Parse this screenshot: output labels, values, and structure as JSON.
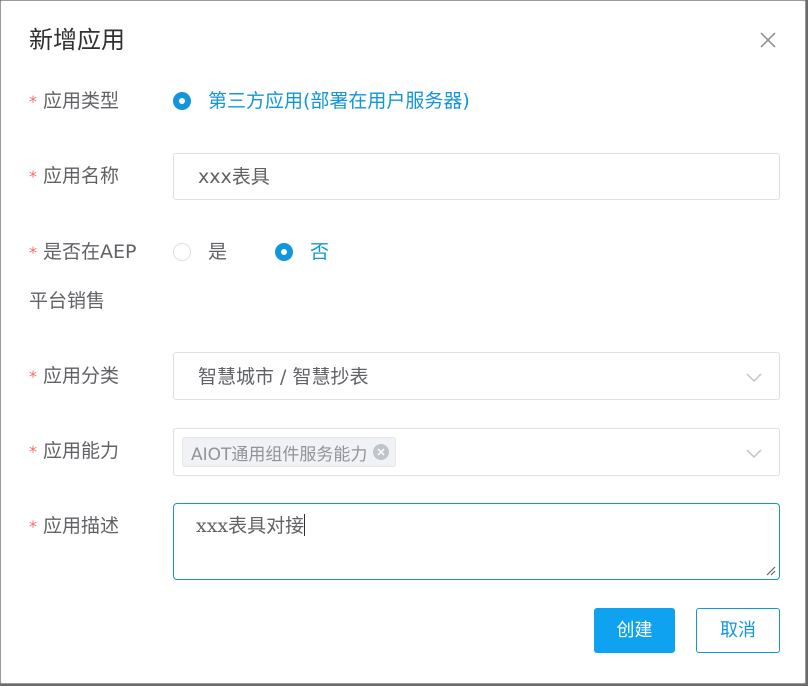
{
  "dialog": {
    "title": "新增应用",
    "close_icon": "close-icon"
  },
  "form": {
    "required_mark": "*",
    "app_type": {
      "label": "应用类型",
      "options": [
        {
          "label": "第三方应用(部署在用户服务器)",
          "selected": true
        }
      ]
    },
    "app_name": {
      "label": "应用名称",
      "value": "xxx表具"
    },
    "aep_sale": {
      "label_line1": "是否在AEP",
      "label_line2": "平台销售",
      "options": [
        {
          "label": "是",
          "selected": false
        },
        {
          "label": "否",
          "selected": true
        }
      ]
    },
    "category": {
      "label": "应用分类",
      "value": "智慧城市 / 智慧抄表"
    },
    "capability": {
      "label": "应用能力",
      "tags": [
        "AIOT通用组件服务能力"
      ]
    },
    "description": {
      "label": "应用描述",
      "value": "xxx表具对接"
    }
  },
  "footer": {
    "create_label": "创建",
    "cancel_label": "取消"
  },
  "colors": {
    "accent": "#1296db",
    "primary_button": "#0fa2f0",
    "required": "#f56c6c",
    "label_text": "#606266",
    "border": "#dcdfe6"
  }
}
